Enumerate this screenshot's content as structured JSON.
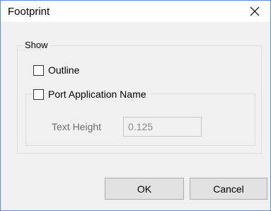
{
  "dialog": {
    "title": "Footprint",
    "close_icon": "close-icon"
  },
  "show_group": {
    "legend": "Show",
    "outline": {
      "label": "Outline",
      "checked": false
    },
    "port_application_name": {
      "label": "Port Application Name",
      "checked": false
    },
    "text_height": {
      "label": "Text Height",
      "value": "0.125",
      "enabled": false
    }
  },
  "buttons": {
    "ok": "OK",
    "cancel": "Cancel"
  }
}
